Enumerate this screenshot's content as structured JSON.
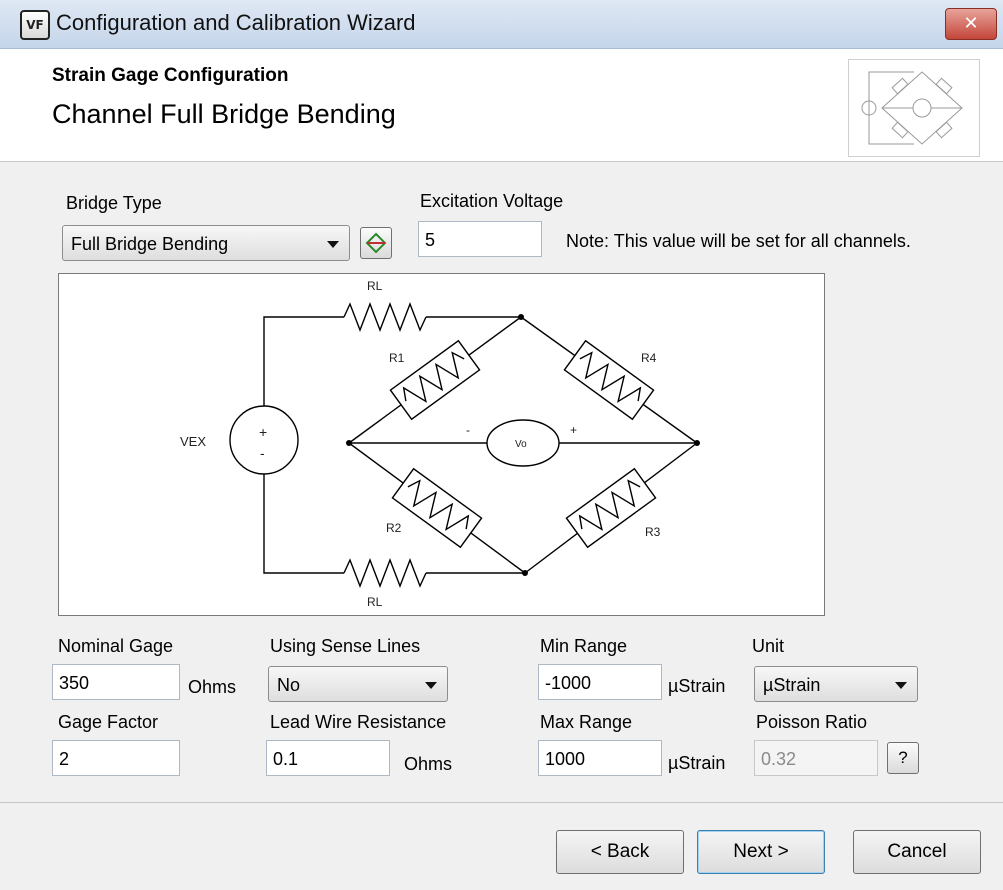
{
  "window": {
    "icon_text": "VF",
    "title": "Configuration and Calibration Wizard",
    "close_glyph": "✕"
  },
  "header": {
    "subtitle": "Strain Gage Configuration",
    "title": "Channel Full Bridge Bending"
  },
  "bridge_type": {
    "label": "Bridge Type",
    "value": "Full Bridge Bending"
  },
  "excitation": {
    "label": "Excitation Voltage",
    "value": "5",
    "note": "Note: This value will be set for all channels."
  },
  "diagram": {
    "vex": "VEX",
    "vex_plus": "+",
    "vex_minus": "-",
    "rl_top": "RL",
    "rl_bottom": "RL",
    "r1": "R1",
    "r2": "R2",
    "r3": "R3",
    "r4": "R4",
    "vo": "Vo",
    "minus": "-",
    "plus": "+"
  },
  "fields": {
    "nominal_gage": {
      "label": "Nominal Gage",
      "value": "350",
      "unit": "Ohms"
    },
    "sense_lines": {
      "label": "Using Sense Lines",
      "value": "No"
    },
    "min_range": {
      "label": "Min Range",
      "value": "-1000",
      "unit": "µStrain"
    },
    "unit": {
      "label": "Unit",
      "value": "µStrain"
    },
    "gage_factor": {
      "label": "Gage Factor",
      "value": "2"
    },
    "lead_wire": {
      "label": "Lead Wire Resistance",
      "value": "0.1",
      "unit": "Ohms"
    },
    "max_range": {
      "label": "Max Range",
      "value": "1000",
      "unit": "µStrain"
    },
    "poisson": {
      "label": "Poisson Ratio",
      "value": "0.32",
      "help": "?"
    }
  },
  "buttons": {
    "back": "< Back",
    "next": "Next >",
    "cancel": "Cancel"
  }
}
